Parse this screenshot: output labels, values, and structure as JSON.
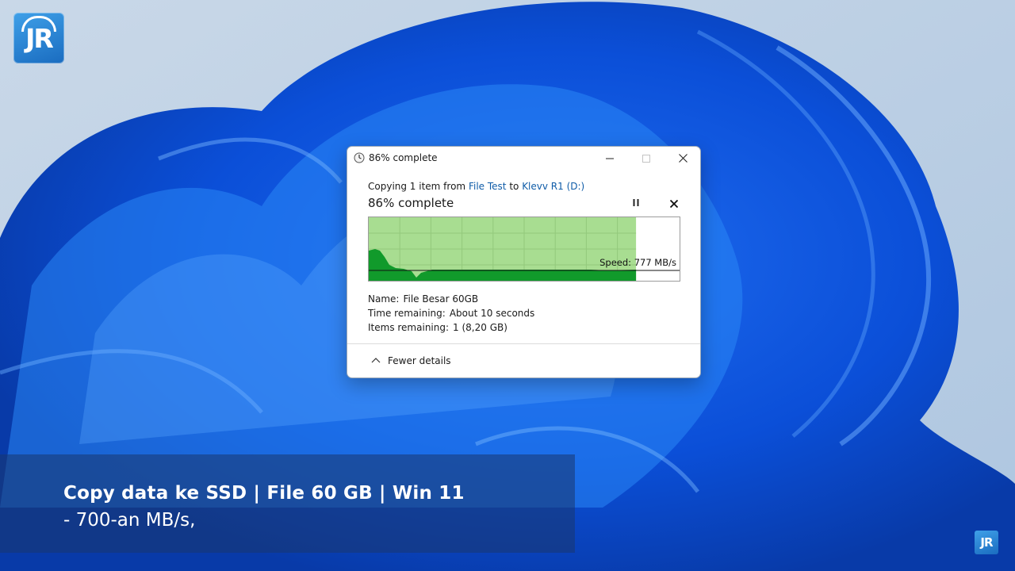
{
  "window": {
    "title": "86% complete",
    "copying_prefix": "Copying 1 item from",
    "source": "File Test",
    "copying_to": "to",
    "destination": "Klevv R1 (D:)",
    "status": "86% complete",
    "progress_percent": 86,
    "speed": "Speed: 777 MB/s",
    "details": {
      "name_label": "Name:",
      "name_value": "File Besar 60GB",
      "time_label": "Time remaining:",
      "time_value": "About 10 seconds",
      "items_label": "Items remaining:",
      "items_value": "1 (8,20 GB)"
    },
    "fewer_details": "Fewer details"
  },
  "caption": {
    "line1": "Copy data ke SSD | File 60 GB | Win 11",
    "line2": "- 700-an MB/s,"
  },
  "logo": {
    "text": "JR"
  },
  "icons": {
    "title": "clock-icon",
    "minimize": "minimize-icon",
    "maximize": "maximize-icon",
    "close": "close-icon",
    "pause": "pause-icon",
    "cancel": "cancel-icon",
    "fewer": "chevron-up-icon"
  },
  "colors": {
    "graph_fill_light": "#a8dd91",
    "graph_fill_dark": "#119a2b",
    "link": "#0f5ca8"
  }
}
